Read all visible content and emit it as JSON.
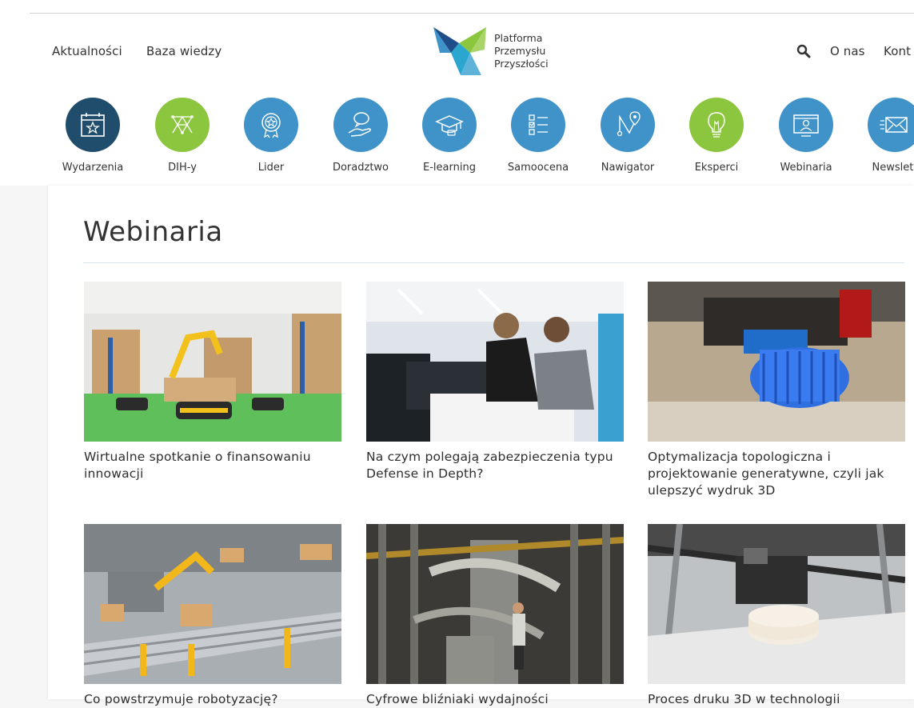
{
  "nav": {
    "left": [
      "Aktualności",
      "Baza wiedzy"
    ],
    "logo_lines": [
      "Platforma",
      "Przemysłu",
      "Przyszłości"
    ],
    "right": [
      "O nas",
      "Kont"
    ]
  },
  "categories": [
    {
      "label": "Wydarzenia",
      "icon": "calendar-star-icon",
      "color": "#1f4d6b"
    },
    {
      "label": "DIH-y",
      "icon": "network-icon",
      "color": "#8cc63f"
    },
    {
      "label": "Lider",
      "icon": "award-icon",
      "color": "#3f93c8"
    },
    {
      "label": "Doradztwo",
      "icon": "advice-hand-icon",
      "color": "#3f93c8"
    },
    {
      "label": "E-learning",
      "icon": "graduation-cap-icon",
      "color": "#3f93c8"
    },
    {
      "label": "Samoocena",
      "icon": "checklist-icon",
      "color": "#3f93c8"
    },
    {
      "label": "Nawigator",
      "icon": "route-pin-icon",
      "color": "#3f93c8"
    },
    {
      "label": "Eksperci",
      "icon": "lightbulb-icon",
      "color": "#8cc63f"
    },
    {
      "label": "Webinaria",
      "icon": "webinar-icon",
      "color": "#3f93c8"
    },
    {
      "label": "Newslett",
      "icon": "envelope-icon",
      "color": "#3f93c8"
    }
  ],
  "page": {
    "title": "Webinaria"
  },
  "webinars": [
    {
      "title": "Wirtualne spotkanie o finansowaniu innowacji"
    },
    {
      "title": "Na czym polegają zabezpieczenia typu Defense in Depth?"
    },
    {
      "title": "Optymalizacja topologiczna i projektowanie generatywne, czyli jak ulepszyć wydruk 3D"
    },
    {
      "title": "Co powstrzymuje robotyzację?"
    },
    {
      "title": "Cyfrowe bliźniaki wydajności"
    },
    {
      "title": "Proces druku 3D w technologii"
    }
  ]
}
